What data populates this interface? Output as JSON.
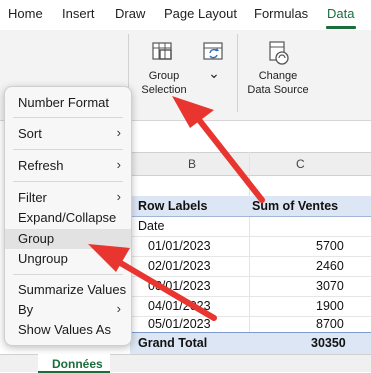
{
  "ribbon_tabs": [
    "Home",
    "Insert",
    "Draw",
    "Page Layout",
    "Formulas",
    "Data"
  ],
  "active_tab": "Data",
  "ribbon": {
    "group_selection_line1": "Group",
    "group_selection_line2": "Selection",
    "dropdown_glyph": "⌄",
    "change_source_line1": "Change",
    "change_source_line2": "Data Source"
  },
  "columns": {
    "b": "B",
    "c": "C"
  },
  "pivot": {
    "row_labels_header": "Row Labels",
    "sum_header": "Sum of Ventes",
    "group_field": "Date",
    "rows": [
      {
        "date": "01/01/2023",
        "value": "5700"
      },
      {
        "date": "02/01/2023",
        "value": "2460"
      },
      {
        "date": "03/01/2023",
        "value": "3070"
      },
      {
        "date": "04/01/2023",
        "value": "1900"
      },
      {
        "date": "05/01/2023",
        "value": "8700"
      }
    ],
    "grand_total_label": "Grand Total",
    "grand_total_value": "30350"
  },
  "context_menu": {
    "number_format": "Number Format",
    "sort": "Sort",
    "refresh": "Refresh",
    "filter": "Filter",
    "expand_collapse": "Expand/Collapse",
    "group": "Group",
    "ungroup": "Ungroup",
    "summarize": "Summarize Values",
    "by": "By",
    "show_values_as": "Show Values As",
    "chevron": "›"
  },
  "sheet_tab": "Données",
  "colors": {
    "accent_green": "#1b6e3b",
    "pivot_header_blue": "#dce6f4",
    "annotation_red": "#e8352f"
  },
  "icons": [
    "group-selection-icon",
    "refresh-grouping-icon",
    "change-data-source-icon",
    "chevron-right-icon"
  ]
}
